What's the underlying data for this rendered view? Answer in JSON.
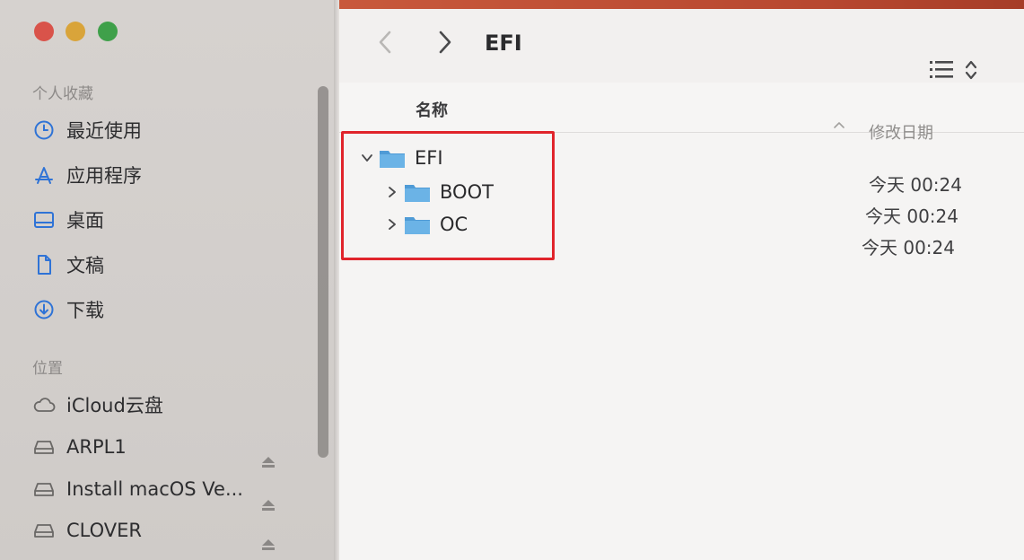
{
  "window": {
    "title": "EFI"
  },
  "sidebar": {
    "favorites_header": "个人收藏",
    "favorites": [
      {
        "label": "最近使用",
        "icon": "clock-icon"
      },
      {
        "label": "应用程序",
        "icon": "applications-icon"
      },
      {
        "label": "桌面",
        "icon": "desktop-icon"
      },
      {
        "label": "文稿",
        "icon": "document-icon"
      },
      {
        "label": "下载",
        "icon": "download-icon"
      }
    ],
    "locations_header": "位置",
    "locations": [
      {
        "label": "iCloud云盘",
        "icon": "cloud-icon"
      },
      {
        "label": "ARPL1",
        "icon": "drive-icon",
        "eject": true
      },
      {
        "label": "Install macOS Ve...",
        "icon": "drive-icon",
        "eject": true
      },
      {
        "label": "CLOVER",
        "icon": "drive-icon",
        "eject": true
      }
    ]
  },
  "columns": {
    "name": "名称",
    "date_modified": "修改日期"
  },
  "files": [
    {
      "name": "EFI",
      "expanded": true,
      "level": 0,
      "date": "今天 00:24"
    },
    {
      "name": "BOOT",
      "expanded": false,
      "level": 1,
      "date": "今天 00:24"
    },
    {
      "name": "OC",
      "expanded": false,
      "level": 1,
      "date": "今天 00:24"
    }
  ],
  "colors": {
    "highlight": "#e0242b",
    "folder": "#5aa6dc",
    "close": "#d9534a",
    "minimize": "#d9a43a",
    "maximize": "#3fa04a"
  }
}
